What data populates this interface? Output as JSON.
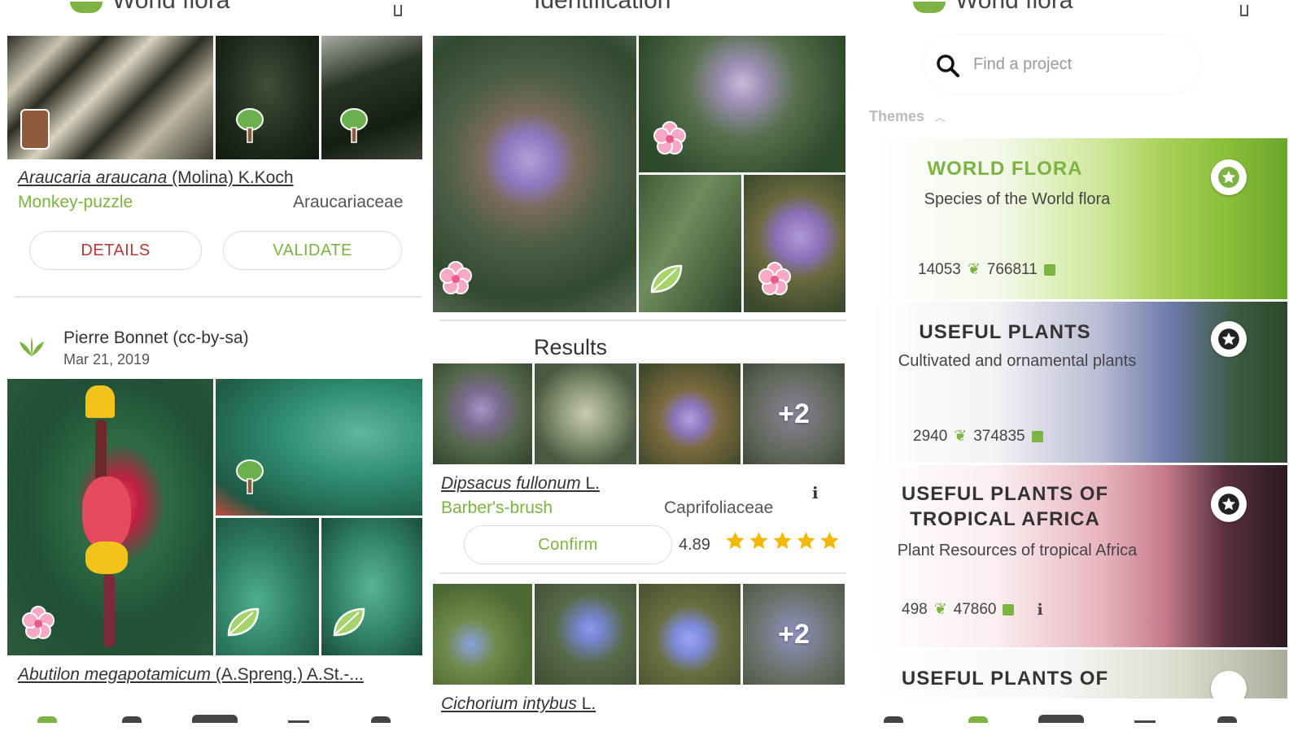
{
  "colors": {
    "green": "#7cb342",
    "details_red": "#b33a3a",
    "star_yellow": "#f5b800"
  },
  "left_panel": {
    "header_title": "World flora",
    "obs1": {
      "scientific": "Araucaria araucana",
      "author": "(Molina) K.Koch",
      "common": "Monkey-puzzle",
      "family": "Araucariaceae",
      "details_label": "DETAILS",
      "validate_label": "VALIDATE"
    },
    "obs2": {
      "author_line": "Pierre Bonnet (cc-by-sa)",
      "date": "Mar 21, 2019",
      "scientific": "Abutilon megapotamicum",
      "author": "(A.Spreng.) A.St.-..."
    }
  },
  "middle_panel": {
    "header_title": "Identification",
    "results_heading": "Results",
    "result1": {
      "more_count": "+2",
      "scientific": "Dipsacus fullonum",
      "author": "L.",
      "common": "Barber's-brush",
      "family": "Caprifoliaceae",
      "confirm_label": "Confirm",
      "score": "4.89",
      "stars": 5
    },
    "result2": {
      "more_count": "+2",
      "scientific": "Cichorium intybus",
      "author": "L."
    }
  },
  "right_panel": {
    "header_title": "World flora",
    "search_placeholder": "Find a project",
    "themes_label": "Themes",
    "projects": [
      {
        "title": "WORLD FLORA",
        "subtitle": "Species of the World flora",
        "species": "14053",
        "images": "766811"
      },
      {
        "title": "USEFUL PLANTS",
        "subtitle": "Cultivated and ornamental plants",
        "species": "2940",
        "images": "374835"
      },
      {
        "title_line1": "USEFUL PLANTS OF",
        "title_line2": "TROPICAL AFRICA",
        "subtitle": "Plant Resources of tropical Africa",
        "species": "498",
        "images": "47860"
      },
      {
        "title": "USEFUL PLANTS OF"
      }
    ]
  }
}
